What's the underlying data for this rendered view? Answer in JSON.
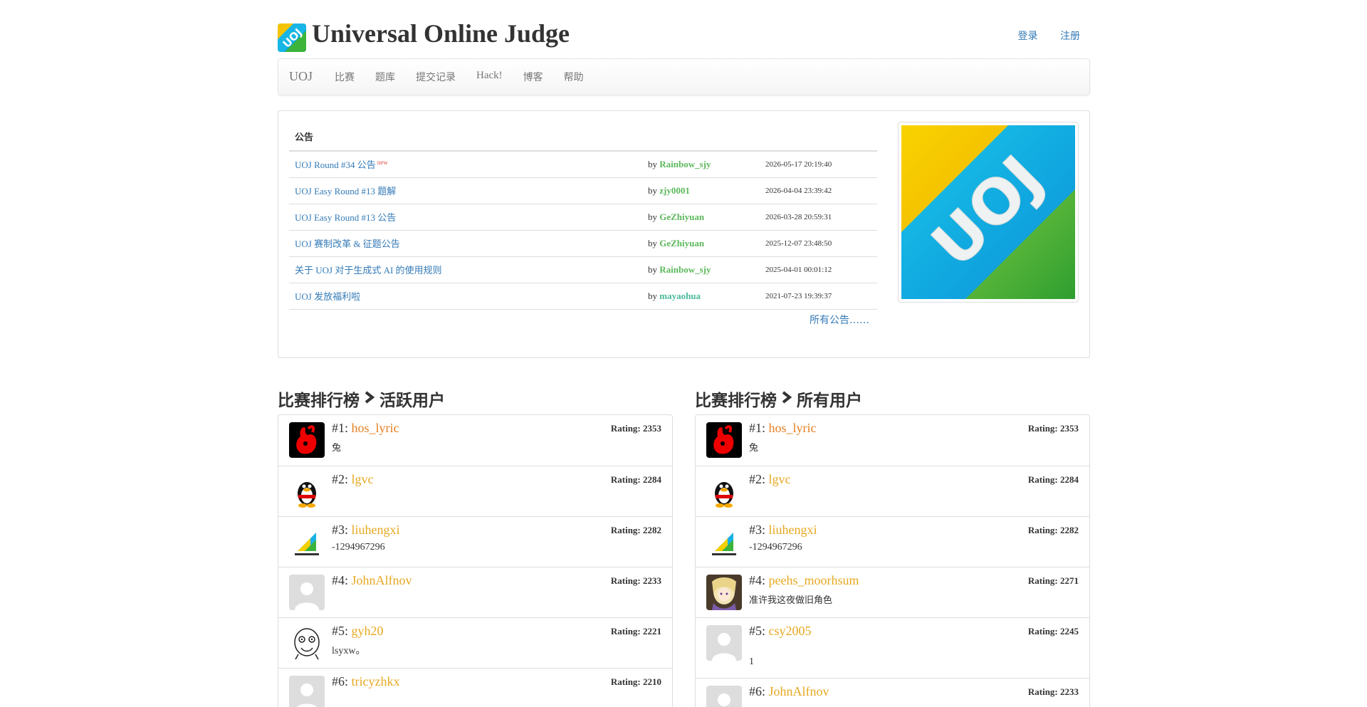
{
  "header": {
    "site_title": "Universal Online Judge",
    "login": "登录",
    "register": "注册"
  },
  "nav": {
    "brand": "UOJ",
    "items": [
      "比赛",
      "题库",
      "提交记录",
      "Hack!",
      "博客",
      "帮助"
    ]
  },
  "announcements": {
    "heading": "公告",
    "new_badge": "new",
    "all_link": "所有公告……",
    "rows": [
      {
        "title": "UOJ Round #34 公告",
        "by": "by",
        "user": "Rainbow_sjy",
        "time": "2026-05-17 20:19:40"
      },
      {
        "title": "UOJ Easy Round #13 题解",
        "by": "by",
        "user": "zjy0001",
        "time": "2026-04-04 23:39:42"
      },
      {
        "title": "UOJ Easy Round #13 公告",
        "by": "by",
        "user": "GeZhiyuan",
        "time": "2026-03-28 20:59:31"
      },
      {
        "title": "UOJ 赛制改革 & 征题公告",
        "by": "by",
        "user": "GeZhiyuan",
        "time": "2025-12-07 23:48:50"
      },
      {
        "title": "关于 UOJ 对于生成式 AI 的使用规则",
        "by": "by",
        "user": "Rainbow_sjy",
        "time": "2025-04-01 00:01:12"
      },
      {
        "title": "UOJ 发放福利啦",
        "by": "by",
        "user": "mayaohua",
        "time": "2021-07-23 19:39:37"
      }
    ]
  },
  "boards": {
    "active": {
      "title_a": "比赛排行榜",
      "title_b": "活跃用户",
      "rows": [
        {
          "rank": "#1:",
          "user": "hos_lyric",
          "rating": "Rating: 2353",
          "motto": "兔"
        },
        {
          "rank": "#2:",
          "user": "lgvc",
          "rating": "Rating: 2284",
          "motto": ""
        },
        {
          "rank": "#3:",
          "user": "liuhengxi",
          "rating": "Rating: 2282",
          "motto": "-1294967296"
        },
        {
          "rank": "#4:",
          "user": "JohnAlfnov",
          "rating": "Rating: 2233",
          "motto": ""
        },
        {
          "rank": "#5:",
          "user": "gyh20",
          "rating": "Rating: 2221",
          "motto": "lsyxw。"
        },
        {
          "rank": "#6:",
          "user": "tricyzhkx",
          "rating": "Rating: 2210",
          "motto": ""
        }
      ]
    },
    "all": {
      "title_a": "比赛排行榜",
      "title_b": "所有用户",
      "rows": [
        {
          "rank": "#1:",
          "user": "hos_lyric",
          "rating": "Rating: 2353",
          "motto": "兔"
        },
        {
          "rank": "#2:",
          "user": "lgvc",
          "rating": "Rating: 2284",
          "motto": ""
        },
        {
          "rank": "#3:",
          "user": "liuhengxi",
          "rating": "Rating: 2282",
          "motto": "-1294967296"
        },
        {
          "rank": "#4:",
          "user": "peehs_moorhsum",
          "rating": "Rating: 2271",
          "motto": "准许我这夜做旧角色"
        },
        {
          "rank": "#5:",
          "user": "csy2005",
          "rating": "Rating: 2245",
          "motto": "1"
        },
        {
          "rank": "#6:",
          "user": "JohnAlfnov",
          "rating": "Rating: 2233",
          "motto": ""
        }
      ]
    }
  },
  "colors": {
    "link": "#337ab7",
    "user_green": "#5cb85c",
    "user_orange": "#e67e22",
    "user_gold": "#e6a821"
  }
}
